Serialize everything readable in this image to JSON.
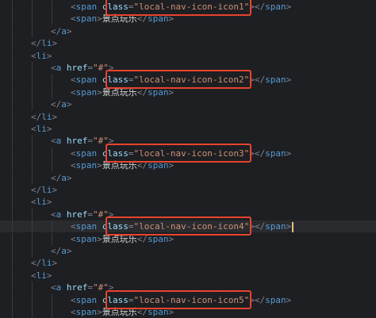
{
  "editor": {
    "language": "html",
    "highlight_color": "#e8432e",
    "lines": [
      {
        "kind": "span-class",
        "indent": 3,
        "value": "local-nav-icon-icon1"
      },
      {
        "kind": "span-text",
        "indent": 3,
        "text": "景点玩乐"
      },
      {
        "kind": "close",
        "indent": 2,
        "tag": "a"
      },
      {
        "kind": "close",
        "indent": 1,
        "tag": "li"
      },
      {
        "kind": "open",
        "indent": 1,
        "tag": "li"
      },
      {
        "kind": "anchor",
        "indent": 2,
        "href": "#"
      },
      {
        "kind": "span-class",
        "indent": 3,
        "value": "local-nav-icon-icon2"
      },
      {
        "kind": "span-text",
        "indent": 3,
        "text": "景点玩乐"
      },
      {
        "kind": "close",
        "indent": 2,
        "tag": "a"
      },
      {
        "kind": "close",
        "indent": 1,
        "tag": "li"
      },
      {
        "kind": "open",
        "indent": 1,
        "tag": "li"
      },
      {
        "kind": "anchor",
        "indent": 2,
        "href": "#"
      },
      {
        "kind": "span-class",
        "indent": 3,
        "value": "local-nav-icon-icon3"
      },
      {
        "kind": "span-text",
        "indent": 3,
        "text": "景点玩乐"
      },
      {
        "kind": "close",
        "indent": 2,
        "tag": "a"
      },
      {
        "kind": "close",
        "indent": 1,
        "tag": "li"
      },
      {
        "kind": "open",
        "indent": 1,
        "tag": "li"
      },
      {
        "kind": "anchor",
        "indent": 2,
        "href": "#"
      },
      {
        "kind": "span-class",
        "indent": 3,
        "value": "local-nav-icon-icon4",
        "current": true
      },
      {
        "kind": "span-text",
        "indent": 3,
        "text": "景点玩乐"
      },
      {
        "kind": "close",
        "indent": 2,
        "tag": "a"
      },
      {
        "kind": "close",
        "indent": 1,
        "tag": "li"
      },
      {
        "kind": "open",
        "indent": 1,
        "tag": "li"
      },
      {
        "kind": "anchor",
        "indent": 2,
        "href": "#"
      },
      {
        "kind": "span-class",
        "indent": 3,
        "value": "local-nav-icon-icon5"
      },
      {
        "kind": "span-text",
        "indent": 3,
        "text": "景点玩乐"
      }
    ]
  }
}
